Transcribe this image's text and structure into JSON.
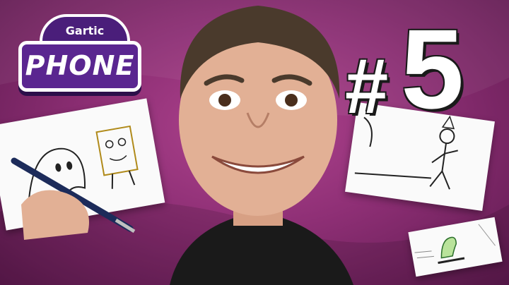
{
  "logo": {
    "top_text": "Gartic",
    "main_text": "PHONE"
  },
  "episode": {
    "hash": "#",
    "number": "5"
  },
  "colors": {
    "background": "#9b3a82",
    "logo_purple": "#5a2690",
    "number_text": "#ffffff"
  }
}
